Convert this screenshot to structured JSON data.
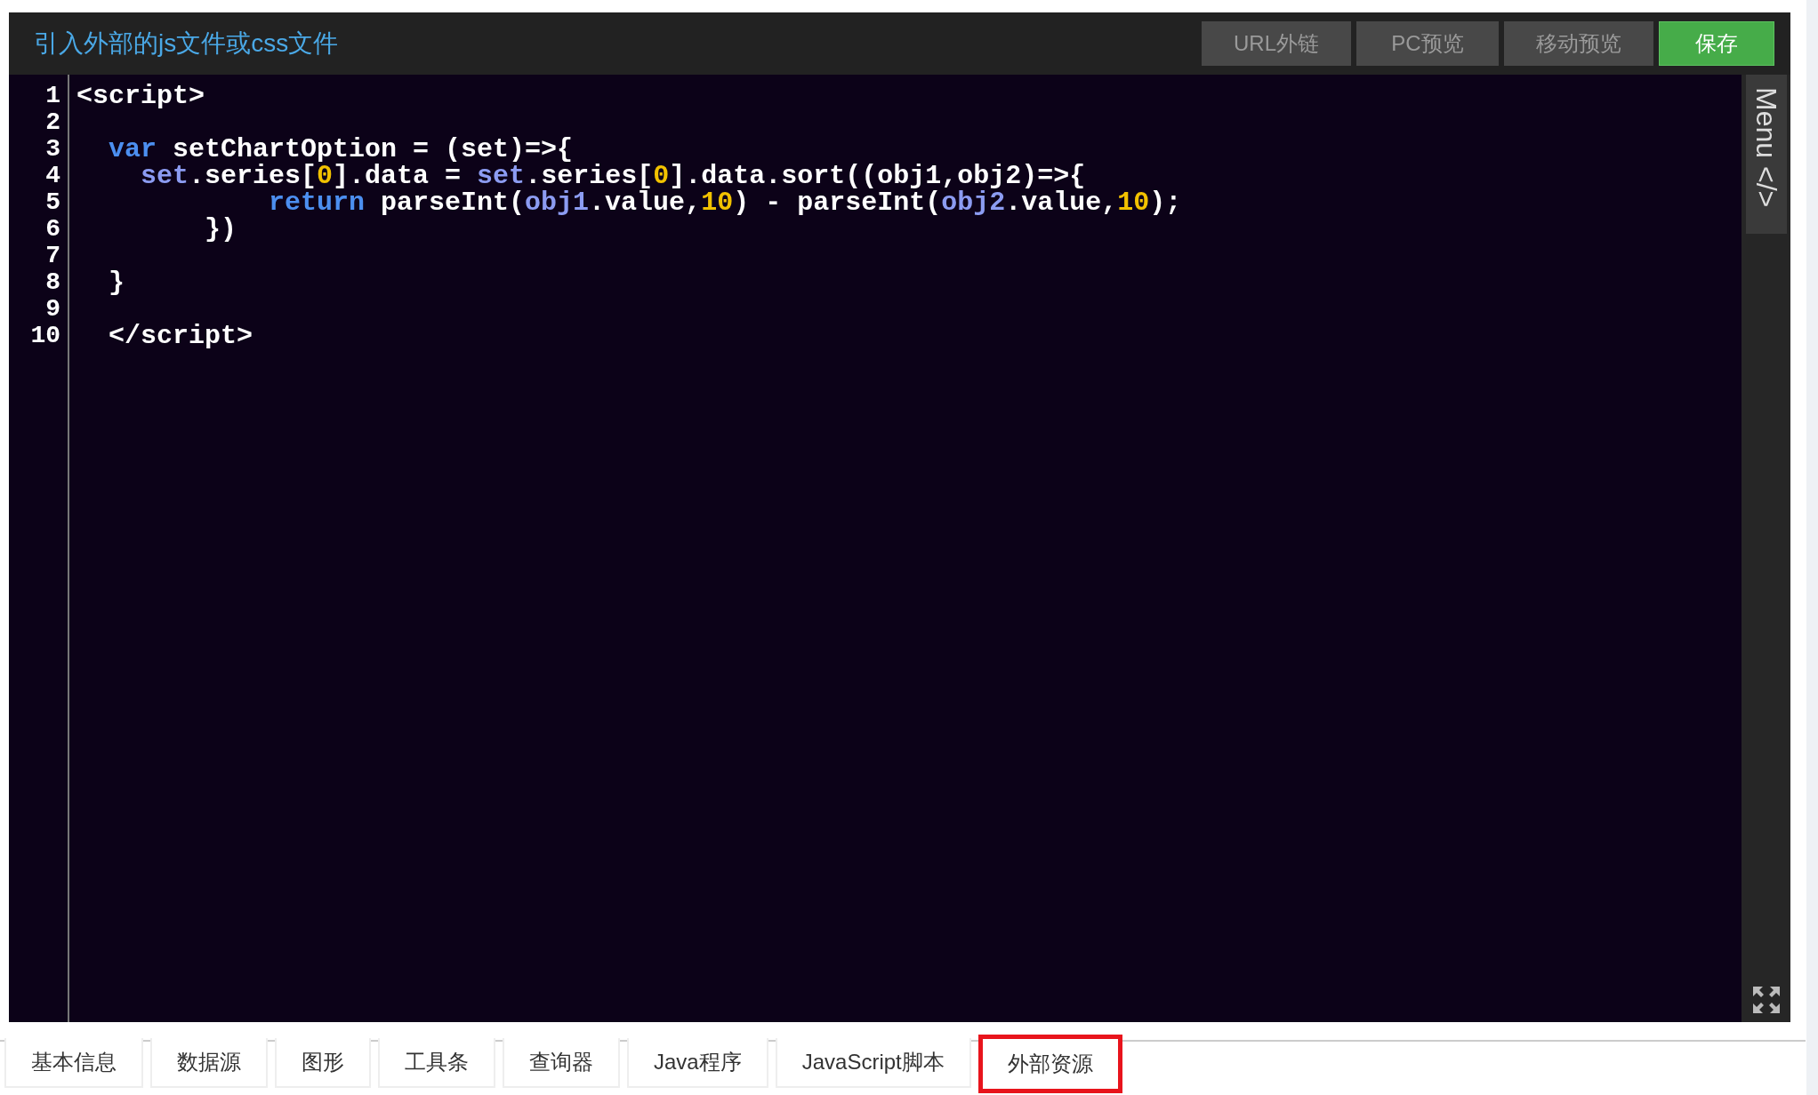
{
  "header": {
    "title": "引入外部的js文件或css文件",
    "buttons": [
      {
        "label": "URL外链",
        "kind": "plain"
      },
      {
        "label": "PC预览",
        "kind": "plain"
      },
      {
        "label": "移动预览",
        "kind": "plain"
      },
      {
        "label": "保存",
        "kind": "primary"
      }
    ]
  },
  "editor": {
    "lines": [
      {
        "number": "1",
        "tokens": [
          {
            "text": "<script>",
            "kind": "plain"
          }
        ]
      },
      {
        "number": "2"
      },
      {
        "number": "3",
        "tokens": [
          {
            "text": "  var",
            "kind": "keyword"
          },
          {
            "text": " setChartOption = (set)=>{",
            "kind": "plain"
          }
        ]
      },
      {
        "number": "4",
        "tokens": [
          {
            "text": "    set",
            "kind": "variable"
          },
          {
            "text": ".series[",
            "kind": "plain"
          },
          {
            "text": "0",
            "kind": "number"
          },
          {
            "text": "].data = ",
            "kind": "plain"
          },
          {
            "text": "set",
            "kind": "variable"
          },
          {
            "text": ".series[",
            "kind": "plain"
          },
          {
            "text": "0",
            "kind": "number"
          },
          {
            "text": "].data.sort((obj1,obj2)=>{",
            "kind": "plain"
          }
        ]
      },
      {
        "number": "5",
        "tokens": [
          {
            "text": "            return",
            "kind": "keyword"
          },
          {
            "text": " parseInt(",
            "kind": "plain"
          },
          {
            "text": "obj1",
            "kind": "variable"
          },
          {
            "text": ".value,",
            "kind": "plain"
          },
          {
            "text": "10",
            "kind": "number"
          },
          {
            "text": ") - parseInt(",
            "kind": "plain"
          },
          {
            "text": "obj2",
            "kind": "variable"
          },
          {
            "text": ".value,",
            "kind": "plain"
          },
          {
            "text": "10",
            "kind": "number"
          },
          {
            "text": ");",
            "kind": "plain"
          }
        ]
      },
      {
        "number": "6",
        "tokens": [
          {
            "text": "        })",
            "kind": "plain"
          }
        ]
      },
      {
        "number": "7"
      },
      {
        "number": "8",
        "tokens": [
          {
            "text": "  }",
            "kind": "plain"
          }
        ]
      },
      {
        "number": "9"
      },
      {
        "number": "10",
        "tokens": [
          {
            "text": "  </script>",
            "kind": "plain"
          }
        ]
      }
    ],
    "menu_label": "Menu </>"
  },
  "tabs": [
    {
      "label": "基本信息",
      "selected": false
    },
    {
      "label": "数据源",
      "selected": false
    },
    {
      "label": "图形",
      "selected": false
    },
    {
      "label": "工具条",
      "selected": false
    },
    {
      "label": "查询器",
      "selected": false
    },
    {
      "label": "Java程序",
      "selected": false
    },
    {
      "label": "JavaScript脚本",
      "selected": false
    },
    {
      "label": "外部资源",
      "selected": true
    }
  ]
}
